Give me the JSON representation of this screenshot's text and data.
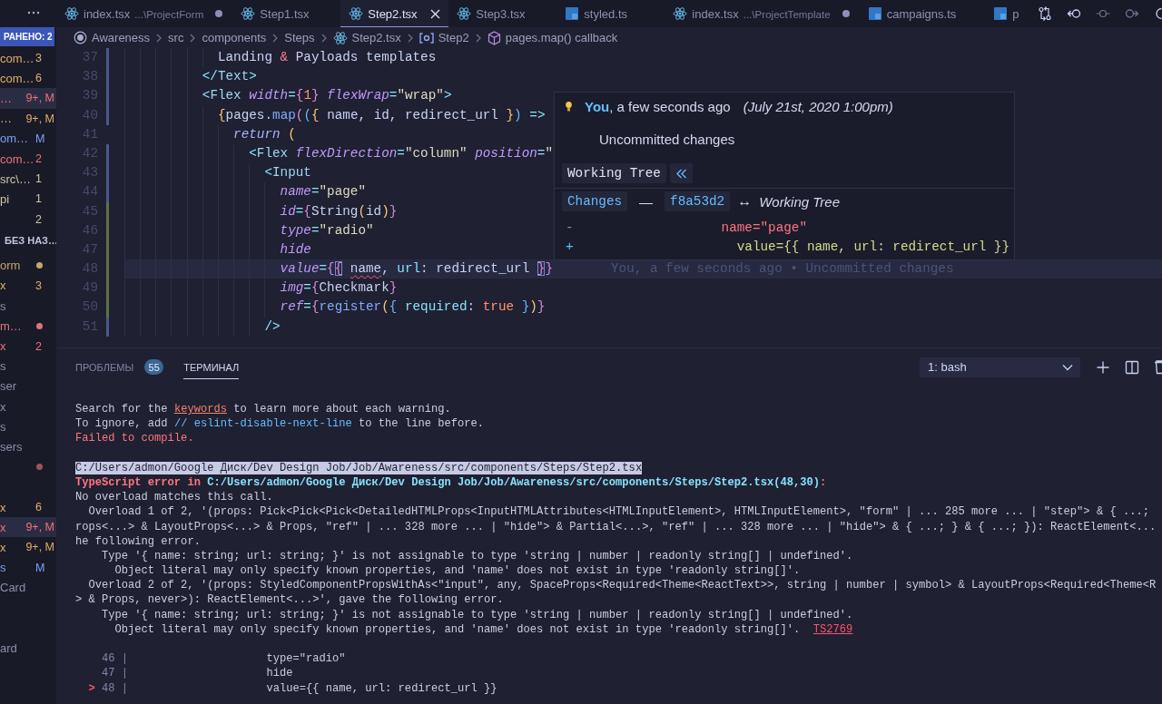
{
  "sidebar": {
    "open_editors": {
      "badge": "РАНЕНО: 2",
      "items": [
        {
          "label": "com…",
          "badge": "3",
          "color": "#e0af68",
          "selected": false
        },
        {
          "label": "com…",
          "badge": "6",
          "color": "#e0af68",
          "selected": false
        },
        {
          "label": "…",
          "badge": "9+, M",
          "color": "#f07178",
          "selected": true
        },
        {
          "label": "…",
          "badge": "9+, M",
          "color": "#e0af68",
          "selected": false
        },
        {
          "label": "om…",
          "badge": "M",
          "color": "#7aa2f7",
          "selected": false
        },
        {
          "label": "com…",
          "badge": "2",
          "color": "#f07178",
          "selected": false
        },
        {
          "label": "src\\…",
          "badge": "1",
          "color": "#cdc6a4",
          "selected": false
        },
        {
          "label": "pi",
          "badge": "1",
          "color": "#cdc6a4",
          "selected": false
        },
        {
          "badge": "2",
          "color": "#cdc6a4",
          "selected": false
        }
      ]
    },
    "folder": {
      "title": "БЕЗ НАЗ…",
      "items": [
        {
          "label": "orm",
          "color": "#c9a46a",
          "selected": false,
          "dot": true
        },
        {
          "label": "x",
          "badge": "3",
          "color": "#e0af68",
          "selected": false,
          "dot": false
        },
        {
          "label": "s",
          "color": "#8a90ab",
          "selected": false,
          "dot": false
        },
        {
          "label": "m…",
          "color": "#e0737b",
          "selected": false,
          "dot": true
        },
        {
          "label": "x",
          "badge": "2",
          "color": "#f07178",
          "selected": false,
          "dot": false
        },
        {
          "label": "s",
          "color": "#8a90ab",
          "selected": false,
          "dot": false
        },
        {
          "label": "ser",
          "color": "#8a90ab",
          "selected": false,
          "dot": false
        },
        {
          "label": "x",
          "color": "#8a90ab",
          "selected": false,
          "dot": false
        },
        {
          "label": "s",
          "color": "#8a90ab",
          "selected": false,
          "dot": false
        },
        {
          "label": "sers",
          "color": "#8a90ab",
          "selected": false,
          "dot": false
        },
        {
          "color": "#a0525b",
          "selected": false,
          "dot": true
        },
        {
          "selected": false,
          "dot": false
        },
        {
          "label": "x",
          "badge": "6",
          "color": "#e0af68",
          "selected": false,
          "dot": false
        },
        {
          "label": "x",
          "badge": "9+, M",
          "color": "#f07178",
          "selected": true,
          "dot": false
        },
        {
          "label": "x",
          "badge": "9+, M",
          "color": "#e0af68",
          "selected": false,
          "dot": false
        },
        {
          "label": "s",
          "badge": "M",
          "color": "#7aa2f7",
          "selected": false,
          "dot": false
        },
        {
          "label": "Card",
          "color": "#8a90ab",
          "selected": false,
          "dot": false
        },
        {
          "selected": false,
          "dot": false
        },
        {
          "selected": false,
          "dot": false
        },
        {
          "label": "ard",
          "color": "#8a90ab",
          "selected": false,
          "dot": false
        }
      ]
    }
  },
  "tabs": [
    {
      "label": "index.tsx",
      "description": "...\\ProjectForm",
      "kind": "tsx",
      "selected": false,
      "dirty": true
    },
    {
      "label": "Step1.tsx",
      "kind": "tsx",
      "selected": false,
      "dirty": false
    },
    {
      "label": "Step2.tsx",
      "kind": "tsx",
      "selected": true,
      "dirty": false
    },
    {
      "label": "Step3.tsx",
      "kind": "tsx",
      "selected": false,
      "dirty": false
    },
    {
      "label": "styled.ts",
      "kind": "ts",
      "selected": false,
      "dirty": false
    },
    {
      "label": "index.tsx",
      "description": "...\\ProjectTemplate",
      "kind": "tsx",
      "selected": false,
      "dirty": true
    },
    {
      "label": "campaigns.ts",
      "kind": "ts",
      "selected": false,
      "dirty": false
    },
    {
      "label": "p",
      "kind": "ts",
      "selected": false,
      "dirty": false
    }
  ],
  "breadcrumb": [
    {
      "label": "Awareness",
      "kind": "root"
    },
    {
      "label": "src",
      "kind": "folder"
    },
    {
      "label": "components",
      "kind": "folder"
    },
    {
      "label": "Steps",
      "kind": "folder"
    },
    {
      "label": "Step2.tsx",
      "kind": "tsx"
    },
    {
      "label": "Step2",
      "kind": "component"
    },
    {
      "label": "pages.map() callback",
      "kind": "callback"
    }
  ],
  "editor": {
    "lines": [
      {
        "number": "37",
        "kind": "modified",
        "current": false,
        "segments": [
          {
            "text": "            Landing ",
            "kind": "plain"
          },
          {
            "text": "&",
            "kind": "entity"
          },
          {
            "text": " Payloads templates",
            "kind": "plain"
          }
        ]
      },
      {
        "number": "38",
        "kind": "modified",
        "current": false,
        "segments": [
          {
            "text": "          </",
            "kind": "tag-bracket"
          },
          {
            "text": "Text",
            "kind": "tag"
          },
          {
            "text": ">",
            "kind": "tag-bracket"
          }
        ]
      },
      {
        "number": "39",
        "kind": "modified",
        "current": false,
        "segments": [
          {
            "text": "          <",
            "kind": "tag-bracket"
          },
          {
            "text": "Flex",
            "kind": "tag"
          },
          {
            "text": " width",
            "kind": "attribute"
          },
          {
            "text": "=",
            "kind": "operator"
          },
          {
            "text": "{",
            "kind": "brace-2"
          },
          {
            "text": "1",
            "kind": "number"
          },
          {
            "text": "}",
            "kind": "brace-2"
          },
          {
            "text": " flexWrap",
            "kind": "attribute"
          },
          {
            "text": "=",
            "kind": "operator"
          },
          {
            "text": "\"wrap\"",
            "kind": "string"
          },
          {
            "text": ">",
            "kind": "tag-bracket"
          }
        ]
      },
      {
        "number": "40",
        "kind": "modified",
        "current": false,
        "segments": [
          {
            "text": "            {",
            "kind": "brace"
          },
          {
            "text": "pages",
            "kind": "plain"
          },
          {
            "text": ".",
            "kind": "operator"
          },
          {
            "text": "map",
            "kind": "function"
          },
          {
            "text": "(",
            "kind": "brace-2"
          },
          {
            "text": "(",
            "kind": "brace-3"
          },
          {
            "text": "{",
            "kind": "brace"
          },
          {
            "text": " name, id, redirect_url ",
            "kind": "plain"
          },
          {
            "text": "}",
            "kind": "brace"
          },
          {
            "text": ")",
            "kind": "brace-3"
          },
          {
            "text": " =>",
            "kind": "operator"
          }
        ]
      },
      {
        "number": "41",
        "kind": "unchanged",
        "current": false,
        "segments": [
          {
            "text": "              return",
            "kind": "keyword"
          },
          {
            "text": " (",
            "kind": "brace"
          }
        ]
      },
      {
        "number": "42",
        "kind": "modified",
        "current": false,
        "segments": [
          {
            "text": "                <",
            "kind": "tag-bracket"
          },
          {
            "text": "Flex",
            "kind": "tag"
          },
          {
            "text": " flexDirection",
            "kind": "attribute"
          },
          {
            "text": "=",
            "kind": "operator"
          },
          {
            "text": "\"column\"",
            "kind": "string"
          },
          {
            "text": " position",
            "kind": "attribute"
          },
          {
            "text": "=",
            "kind": "operator"
          },
          {
            "text": "\"",
            "kind": "string"
          }
        ]
      },
      {
        "number": "43",
        "kind": "modified",
        "current": false,
        "segments": [
          {
            "text": "                  <",
            "kind": "tag-bracket"
          },
          {
            "text": "Input",
            "kind": "tag"
          }
        ]
      },
      {
        "number": "44",
        "kind": "modified",
        "current": false,
        "segments": [
          {
            "text": "                    name",
            "kind": "attribute"
          },
          {
            "text": "=",
            "kind": "operator"
          },
          {
            "text": "\"page\"",
            "kind": "string"
          }
        ]
      },
      {
        "number": "45",
        "kind": "added",
        "current": false,
        "segments": [
          {
            "text": "                    id",
            "kind": "attribute"
          },
          {
            "text": "=",
            "kind": "operator"
          },
          {
            "text": "{",
            "kind": "brace-2"
          },
          {
            "text": "String",
            "kind": "plain"
          },
          {
            "text": "(",
            "kind": "brace"
          },
          {
            "text": "id",
            "kind": "plain"
          },
          {
            "text": ")",
            "kind": "brace"
          },
          {
            "text": "}",
            "kind": "brace-2"
          }
        ]
      },
      {
        "number": "46",
        "kind": "added",
        "current": false,
        "segments": [
          {
            "text": "                    type",
            "kind": "attribute"
          },
          {
            "text": "=",
            "kind": "operator"
          },
          {
            "text": "\"radio\"",
            "kind": "string"
          }
        ]
      },
      {
        "number": "47",
        "kind": "added",
        "current": false,
        "segments": [
          {
            "text": "                    hide",
            "kind": "attribute"
          }
        ]
      },
      {
        "number": "48",
        "kind": "added",
        "current": true,
        "blame": "You, a few seconds ago • Uncommitted changes",
        "segments": [
          {
            "text": "                    value",
            "kind": "attribute"
          },
          {
            "text": "=",
            "kind": "operator"
          },
          {
            "text": "{",
            "kind": "brace-2"
          },
          {
            "text": "{",
            "kind": "bracket-match"
          },
          {
            "text": " name",
            "kind": "error"
          },
          {
            "text": ", ",
            "kind": "plain"
          },
          {
            "text": "url",
            "kind": "property"
          },
          {
            "text": ": redirect_url ",
            "kind": "plain"
          },
          {
            "text": "}",
            "kind": "bracket-match"
          },
          {
            "text": "}",
            "kind": "brace-2"
          }
        ]
      },
      {
        "number": "49",
        "kind": "added",
        "current": false,
        "segments": [
          {
            "text": "                    img",
            "kind": "attribute"
          },
          {
            "text": "=",
            "kind": "operator"
          },
          {
            "text": "{",
            "kind": "brace-2"
          },
          {
            "text": "Checkmark",
            "kind": "plain"
          },
          {
            "text": "}",
            "kind": "brace-2"
          }
        ]
      },
      {
        "number": "50",
        "kind": "added",
        "current": false,
        "segments": [
          {
            "text": "                    ref",
            "kind": "attribute"
          },
          {
            "text": "=",
            "kind": "operator"
          },
          {
            "text": "{",
            "kind": "brace-2"
          },
          {
            "text": "register",
            "kind": "function"
          },
          {
            "text": "(",
            "kind": "brace"
          },
          {
            "text": "{",
            "kind": "brace-3"
          },
          {
            "text": " required",
            "kind": "property"
          },
          {
            "text": ": ",
            "kind": "plain"
          },
          {
            "text": "true",
            "kind": "number"
          },
          {
            "text": " }",
            "kind": "brace-3"
          },
          {
            "text": ")",
            "kind": "brace"
          },
          {
            "text": "}",
            "kind": "brace-2"
          }
        ]
      },
      {
        "number": "51",
        "kind": "modified",
        "current": false,
        "segments": [
          {
            "text": "                  />",
            "kind": "tag-bracket"
          }
        ]
      }
    ],
    "hover": {
      "byline": "**You**, a few seconds ago",
      "date": "(July 21st, 2020 1:00pm)",
      "message": "Uncommitted changes",
      "ref": "Working Tree",
      "changes": "Changes",
      "dash": "—",
      "commit": "f8a53d2",
      "arrow": "↔",
      "target": "Working Tree",
      "diff": [
        {
          "sign": "-",
          "text": "                  name=\"page\"",
          "kind": "removed"
        },
        {
          "sign": "+",
          "text": "                    value={{ name, url: redirect_url }}",
          "kind": "added"
        }
      ]
    }
  },
  "panel": {
    "tabs": [
      {
        "label": "ПРОБЛЕМЫ",
        "count": "55",
        "selected": false
      },
      {
        "label": "ТЕРМИНАЛ",
        "selected": true
      }
    ],
    "terminal_select": "1: bash",
    "terminal": {
      "blocks": [
        [
          {
            "segments": [
              {
                "text": "Search for the ",
                "kind": "plain"
              },
              {
                "text": "keywords",
                "kind": "link"
              },
              {
                "text": " to learn more about each warning.",
                "kind": "plain"
              }
            ]
          },
          {
            "segments": [
              {
                "text": "To ignore, add ",
                "kind": "plain"
              },
              {
                "text": "// eslint-disable-next-line",
                "kind": "comment"
              },
              {
                "text": " to the line before.",
                "kind": "plain"
              }
            ]
          },
          {
            "segments": [
              {
                "text": "Failed to compile.",
                "kind": "error"
              }
            ]
          }
        ],
        [
          {
            "segments": [
              {
                "text": "C:/Users/admon/Google Диск/Dev Design Job/Job/Awareness/src/components/Steps/Step2.tsx",
                "kind": "selection"
              }
            ]
          },
          {
            "segments": [
              {
                "text": "TypeScript error in ",
                "kind": "error-bold"
              },
              {
                "text": "C:/Users/admon/Google Диск/Dev Design Job/Job/Awareness/src/components/Steps/Step2.tsx(48,30)",
                "kind": "path"
              },
              {
                "text": ":",
                "kind": "error-bold"
              }
            ]
          },
          {
            "segments": [
              {
                "text": "No overload matches this call.",
                "kind": "plain"
              }
            ]
          },
          {
            "segments": [
              {
                "text": "  Overload 1 of 2, '(props: Pick<Pick<Pick<DetailedHTMLProps<InputHTMLAttributes<HTMLInputElement>, HTMLInputElement>, \"form\" | ... 285 more ... | \"step\"> & { ...;",
                "kind": "plain"
              }
            ]
          },
          {
            "segments": [
              {
                "text": "rops<...> & LayoutProps<...> & Props, \"ref\" | ... 328 more ... | \"hide\"> & Partial<...>, \"ref\" | ... 328 more ... | \"hide\"> & { ...; } & { ...; }): ReactElement<...",
                "kind": "plain"
              }
            ]
          },
          {
            "segments": [
              {
                "text": "he following error.",
                "kind": "plain"
              }
            ]
          },
          {
            "segments": [
              {
                "text": "    Type '{ name: string; url: string; }' is not assignable to type 'string | number | readonly string[] | undefined'.",
                "kind": "plain"
              }
            ]
          },
          {
            "segments": [
              {
                "text": "      Object literal may only specify known properties, and 'name' does not exist in type 'readonly string[]'.",
                "kind": "plain"
              }
            ]
          },
          {
            "segments": [
              {
                "text": "  Overload 2 of 2, '(props: StyledComponentPropsWithAs<\"input\", any, SpaceProps<Required<Theme<ReactText>>, string | number | symbol> & LayoutProps<Required<Theme<R",
                "kind": "plain"
              }
            ]
          },
          {
            "segments": [
              {
                "text": "> & Props, never>): ReactElement<...>', gave the following error.",
                "kind": "plain"
              }
            ]
          },
          {
            "segments": [
              {
                "text": "    Type '{ name: string; url: string; }' is not assignable to type 'string | number | readonly string[] | undefined'.",
                "kind": "plain"
              }
            ]
          },
          {
            "segments": [
              {
                "text": "      Object literal may only specify known properties, and 'name' does not exist in type 'readonly string[]'.  ",
                "kind": "plain"
              },
              {
                "text": "TS2769",
                "kind": "code-link"
              }
            ]
          }
        ],
        [
          {
            "segments": [
              {
                "text": "    46 |",
                "kind": "gutter"
              },
              {
                "text": "                     type=\"radio\"",
                "kind": "plain"
              }
            ]
          },
          {
            "segments": [
              {
                "text": "    47 |",
                "kind": "gutter"
              },
              {
                "text": "                     hide",
                "kind": "plain"
              }
            ]
          },
          {
            "segments": [
              {
                "text": "  >",
                "kind": "marker"
              },
              {
                "text": " 48 |",
                "kind": "gutter"
              },
              {
                "text": "                     value={{ name, url: redirect_url }}",
                "kind": "plain"
              }
            ]
          }
        ]
      ]
    }
  }
}
